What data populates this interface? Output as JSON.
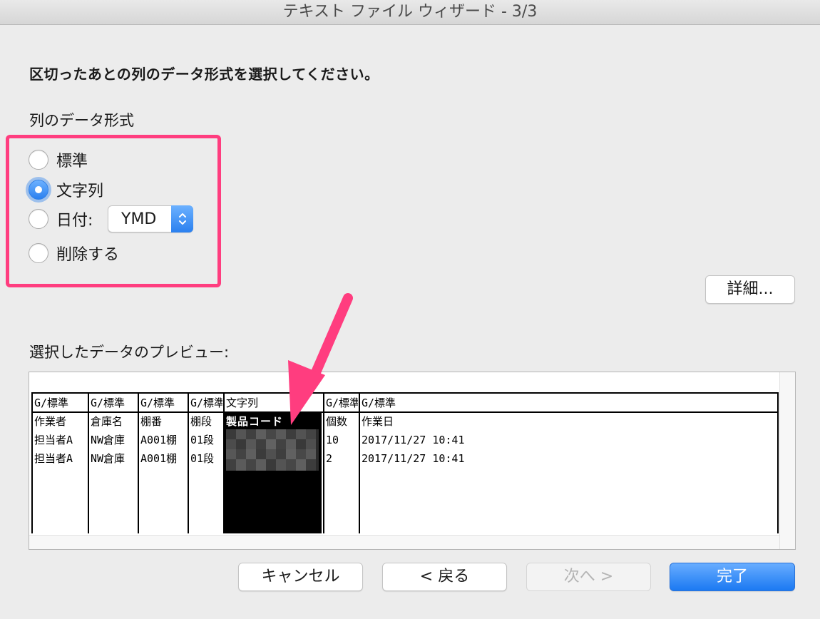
{
  "window": {
    "title": "テキスト ファイル ウィザード - 3/3"
  },
  "instruction": "区切ったあとの列のデータ形式を選択してください。",
  "column_format": {
    "group_label": "列のデータ形式",
    "options": [
      {
        "label": "標準",
        "checked": false
      },
      {
        "label": "文字列",
        "checked": true
      },
      {
        "label": "日付:",
        "checked": false
      },
      {
        "label": "削除する",
        "checked": false
      }
    ],
    "date_format_value": "YMD"
  },
  "buttons": {
    "advanced": "詳細...",
    "cancel": "キャンセル",
    "back": "< 戻る",
    "next": "次へ >",
    "finish": "完了"
  },
  "preview": {
    "label": "選択したデータのプレビュー:",
    "header": [
      "G/標準",
      "G/標準",
      "G/標準",
      "G/標準",
      "文字列",
      "G/標準",
      "G/標準"
    ],
    "rows": [
      [
        "作業者",
        "倉庫名",
        "棚番",
        "棚段",
        "製品コード",
        "個数",
        "作業日"
      ],
      [
        "担当者A",
        "NW倉庫",
        "A001棚",
        "01段",
        "",
        "10",
        "2017/11/27 10:41"
      ],
      [
        "担当者A",
        "NW倉庫",
        "A001棚",
        "01段",
        "",
        "2",
        "2017/11/27 10:41"
      ]
    ]
  },
  "colors": {
    "highlight": "#ff3d7f",
    "accent_blue": "#2a80ef",
    "selected_column": "#000000"
  }
}
